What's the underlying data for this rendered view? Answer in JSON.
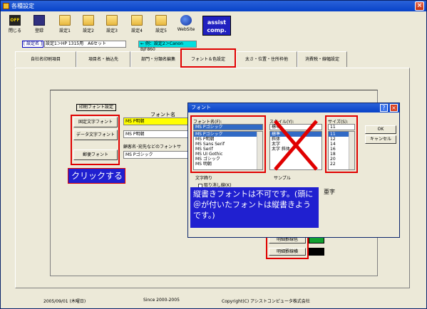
{
  "window": {
    "title": "各種設定",
    "close": "×"
  },
  "toolbar": {
    "items": [
      {
        "label": "閉じる",
        "icon": "off-icon",
        "glyph": "OFF"
      },
      {
        "label": "登録",
        "icon": "save-icon"
      },
      {
        "label": "設定1",
        "icon": "folder-icon"
      },
      {
        "label": "設定2",
        "icon": "folder-icon"
      },
      {
        "label": "設定3",
        "icon": "folder-icon"
      },
      {
        "label": "設定4",
        "icon": "folder-icon"
      },
      {
        "label": "設定5",
        "icon": "folder-icon"
      },
      {
        "label": "WebSite",
        "icon": "globe-icon"
      }
    ],
    "assist_line1": "assist",
    "assist_line2": "comp."
  },
  "setting": {
    "label": "[ 設定名 ]",
    "value": "設定1＞HP 1315用　A6セット",
    "hint": "← 例：設定2＞Canon BJF860"
  },
  "tabs": [
    "自社名印刷項目",
    "項目名・抽込先",
    "部門・分類名編集",
    "フォント＆色設定",
    "太さ・位置・住所枠他",
    "消費税・線幅設定"
  ],
  "panel": {
    "group_button": "印刷フォント設定",
    "font_header": "フォント名",
    "buttons": [
      "固定文字フォント",
      "データ文字フォント",
      "郵便フォント"
    ],
    "fields": [
      "MS P明朝",
      "MS P明朝",
      "MS Pゴシック"
    ],
    "subject_label": "顧客名･宛先などのフォントサ",
    "click_note": "クリックする",
    "color_buttons": [
      "明細罫線色",
      "明細罫線横"
    ]
  },
  "dialog": {
    "title": "フォント",
    "help": "?",
    "close": "×",
    "font_label": "フォント名(F):",
    "font_value": "MS Pゴシック",
    "font_items": [
      "MS Pゴシック",
      "MS P明朝",
      "MS Sans Serif",
      "MS Serif",
      "MS UI Gothic",
      "MS ゴシック",
      "MS 明朝"
    ],
    "style_label": "スタイル(Y):",
    "style_value": "標準",
    "style_items": [
      "標準",
      "斜体",
      "太字",
      "太字 斜体"
    ],
    "size_label": "サイズ(S):",
    "size_value": "11",
    "size_items": [
      "11",
      "12",
      "14",
      "16",
      "18",
      "20",
      "22"
    ],
    "ok": "OK",
    "cancel": "キャンセル",
    "effects_label": "文字飾り",
    "strike_label": "取り消し線(K)",
    "sample_label": "サンプル",
    "sample_text": "亜字",
    "note": "縦書きフォントは不可です。(頭に＠が付いたフォントは縦書きようです。)"
  },
  "status": {
    "date": "2005/09/01 (木曜日)",
    "since": "Since 2000-2005",
    "copyright": "Copyright(C) アシストコンピュータ株式会社"
  },
  "colors": {
    "accent_red": "#E00000",
    "annotation_blue": "#2020D0",
    "title_blue": "#0842C8"
  }
}
